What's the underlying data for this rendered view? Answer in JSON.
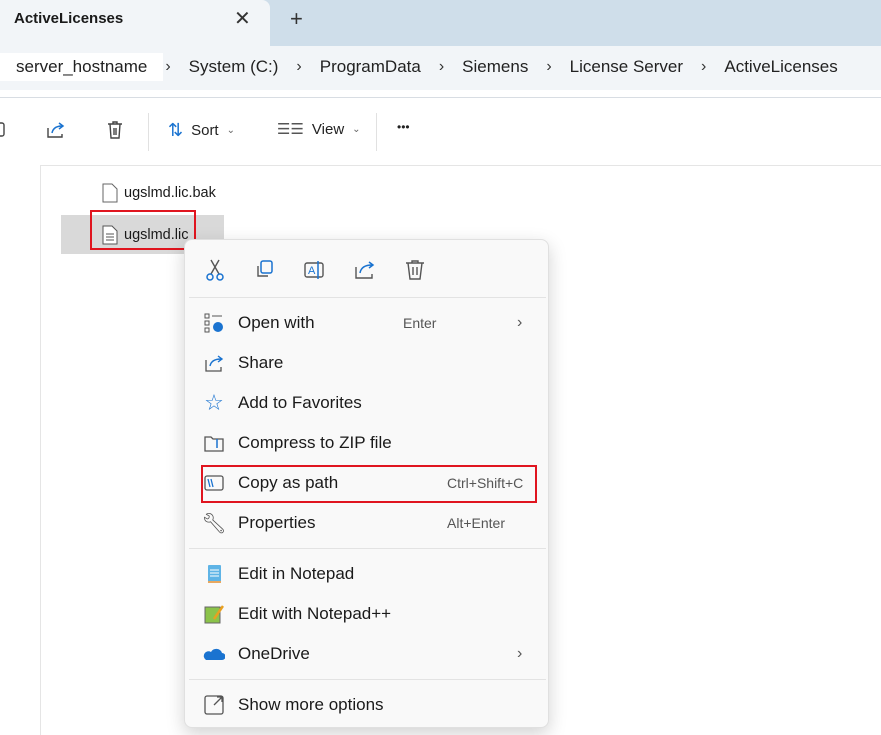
{
  "tab": {
    "title": "ActiveLicenses",
    "close": "✕",
    "new": "+"
  },
  "breadcrumb": [
    "server_hostname",
    "System (C:)",
    "ProgramData",
    "Siemens",
    "License Server",
    "ActiveLicenses"
  ],
  "toolbar": {
    "sort": "Sort",
    "view": "View",
    "more": "•••"
  },
  "files": [
    {
      "name": "ugslmd.lic.bak"
    },
    {
      "name": "ugslmd.lic",
      "selected": true
    }
  ],
  "menu": {
    "quick_actions": [
      "cut-icon",
      "copy-icon",
      "rename-icon",
      "share-icon",
      "delete-icon"
    ],
    "items": [
      {
        "label": "Open with",
        "shortcut": "Enter",
        "submenu": true
      },
      {
        "label": "Share"
      },
      {
        "label": "Add to Favorites"
      },
      {
        "label": "Compress to ZIP file"
      },
      {
        "label": "Copy as path",
        "shortcut": "Ctrl+Shift+C",
        "highlighted": true
      },
      {
        "label": "Properties",
        "shortcut": "Alt+Enter"
      },
      {
        "label": "Edit in Notepad"
      },
      {
        "label": "Edit with Notepad++"
      },
      {
        "label": "OneDrive",
        "submenu": true
      },
      {
        "label": "Show more options"
      }
    ]
  },
  "colors": {
    "highlight_box": "#e0151f",
    "accent": "#1a73d0"
  }
}
